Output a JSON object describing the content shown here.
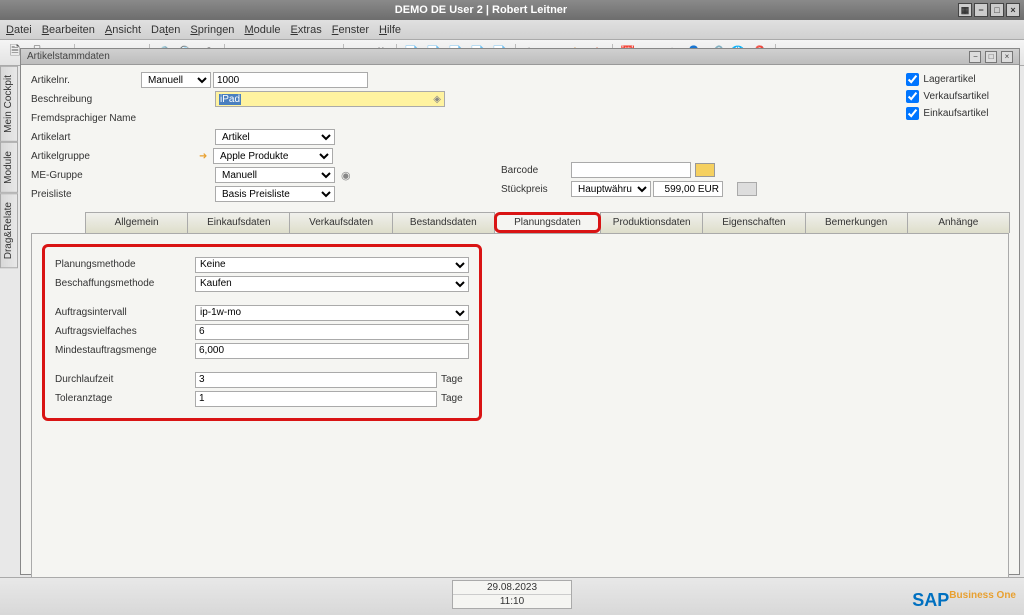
{
  "titlebar": {
    "title": "DEMO DE User 2 | Robert Leitner"
  },
  "menu": [
    "Datei",
    "Bearbeiten",
    "Ansicht",
    "Daten",
    "Springen",
    "Module",
    "Extras",
    "Fenster",
    "Hilfe"
  ],
  "sidetabs": [
    "Mein Cockpit",
    "Module",
    "Drag&Relate"
  ],
  "window": {
    "title": "Artikelstammdaten"
  },
  "header": {
    "artikelnr_label": "Artikelnr.",
    "artikelnr_mode": "Manuell",
    "artikelnr_value": "1000",
    "beschreibung_label": "Beschreibung",
    "beschreibung_value": "iPad",
    "fremdsprache_label": "Fremdsprachiger Name",
    "artikelart_label": "Artikelart",
    "artikelart_value": "Artikel",
    "artikelgruppe_label": "Artikelgruppe",
    "artikelgruppe_value": "Apple Produkte",
    "megruppe_label": "ME-Gruppe",
    "megruppe_value": "Manuell",
    "preisliste_label": "Preisliste",
    "preisliste_value": "Basis Preisliste",
    "barcode_label": "Barcode",
    "stueckpreis_label": "Stückpreis",
    "stueckpreis_currency": "Hauptwährung",
    "stueckpreis_value": "599,00 EUR"
  },
  "checks": {
    "lagerartikel": "Lagerartikel",
    "verkaufsartikel": "Verkaufsartikel",
    "einkaufsartikel": "Einkaufsartikel"
  },
  "tabs": [
    "Allgemein",
    "Einkaufsdaten",
    "Verkaufsdaten",
    "Bestandsdaten",
    "Planungsdaten",
    "Produktionsdaten",
    "Eigenschaften",
    "Bemerkungen",
    "Anhänge"
  ],
  "planning": {
    "planungsmethode_label": "Planungsmethode",
    "planungsmethode_value": "Keine",
    "beschaffungsmethode_label": "Beschaffungsmethode",
    "beschaffungsmethode_value": "Kaufen",
    "auftragsintervall_label": "Auftragsintervall",
    "auftragsintervall_value": "ip-1w-mo",
    "auftragsvielfaches_label": "Auftragsvielfaches",
    "auftragsvielfaches_value": "6",
    "mindestauftragsmenge_label": "Mindestauftragsmenge",
    "mindestauftragsmenge_value": "6,000",
    "durchlaufzeit_label": "Durchlaufzeit",
    "durchlaufzeit_value": "3",
    "durchlaufzeit_unit": "Tage",
    "toleranztage_label": "Toleranztage",
    "toleranztage_value": "1",
    "toleranztage_unit": "Tage"
  },
  "status": {
    "date": "29.08.2023",
    "time": "11:10"
  },
  "logo": {
    "sap": "SAP",
    "b1": "Business One"
  }
}
